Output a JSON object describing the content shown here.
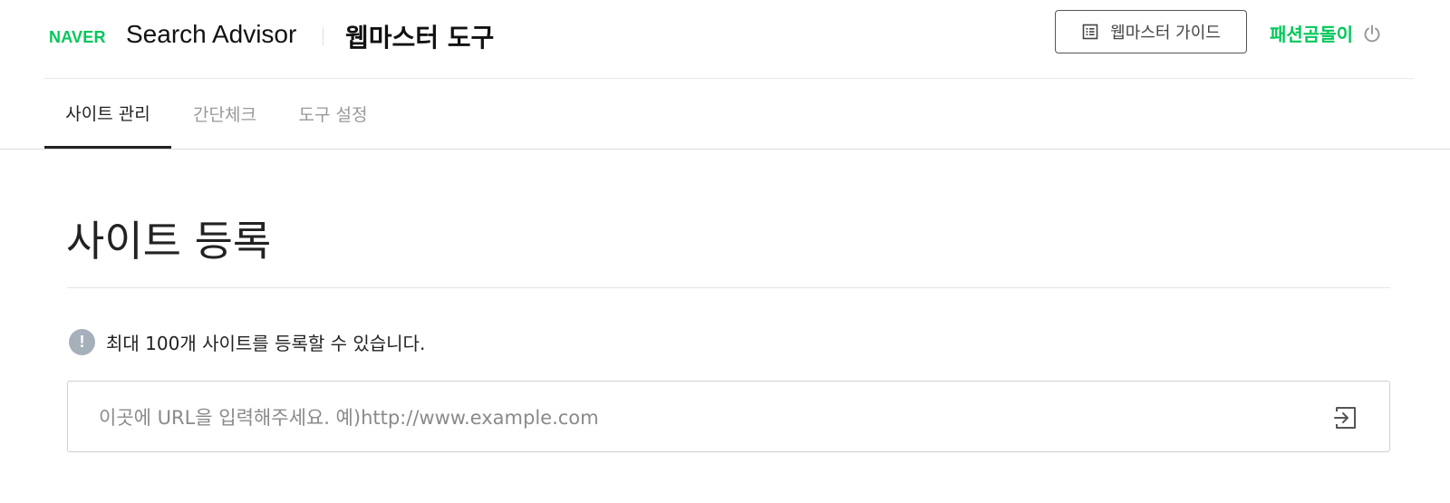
{
  "header": {
    "logo_text": "NAVER",
    "brand_title": "Search Advisor",
    "tool_title": "웹마스터 도구",
    "guide_button_label": "웹마스터 가이드",
    "user_name": "패션곰돌이",
    "icons": {
      "guide": "document-list-icon",
      "logout": "power-icon"
    },
    "colors": {
      "brand": "#03c75a"
    }
  },
  "tabs": [
    {
      "label": "사이트 관리",
      "active": true
    },
    {
      "label": "간단체크",
      "active": false
    },
    {
      "label": "도구 설정",
      "active": false
    }
  ],
  "main": {
    "page_title": "사이트 등록",
    "notice_icon_glyph": "!",
    "notice_text": "최대 100개 사이트를 등록할 수 있습니다.",
    "url_input": {
      "value": "",
      "placeholder": "이곳에 URL을 입력해주세요. 예)http://www.example.com"
    },
    "icons": {
      "notice": "info-exclamation-icon",
      "submit": "enter-arrow-icon"
    }
  }
}
